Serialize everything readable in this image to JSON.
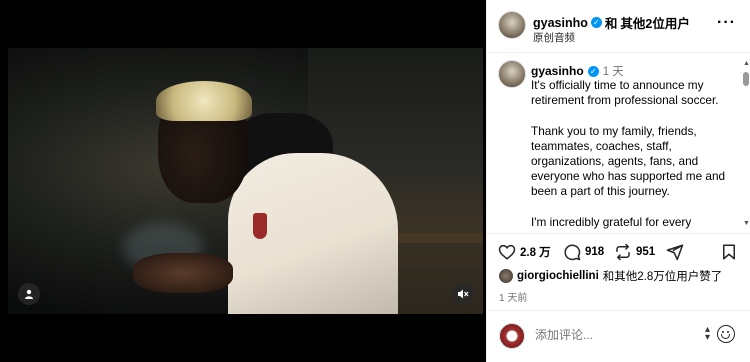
{
  "header": {
    "username": "gyasinho",
    "and_text": "和",
    "others_text": "其他2位用户",
    "subtitle": "原创音频",
    "more_icon": "more-horizontal-icon"
  },
  "caption": {
    "username": "gyasinho",
    "time": "1 天",
    "paragraphs": [
      "It's officially time to announce my retirement from professional soccer.",
      "Thank you to my family, friends, teammates, coaches, staff, organizations, agents, fans, and everyone who has supported me and been a part of this journey.",
      "I'm incredibly grateful for every opportunity, every person, and every"
    ]
  },
  "actions": {
    "likes_count": "2.8 万",
    "comments_count": "918",
    "reposts_count": "951"
  },
  "likes_line": {
    "user": "giorgiochiellini",
    "rest": "和其他2.8万位用户赞了"
  },
  "post_time": "1 天前",
  "comment": {
    "placeholder": "添加评论..."
  },
  "colors": {
    "verified": "#0095f6",
    "muted_text": "#737373"
  }
}
